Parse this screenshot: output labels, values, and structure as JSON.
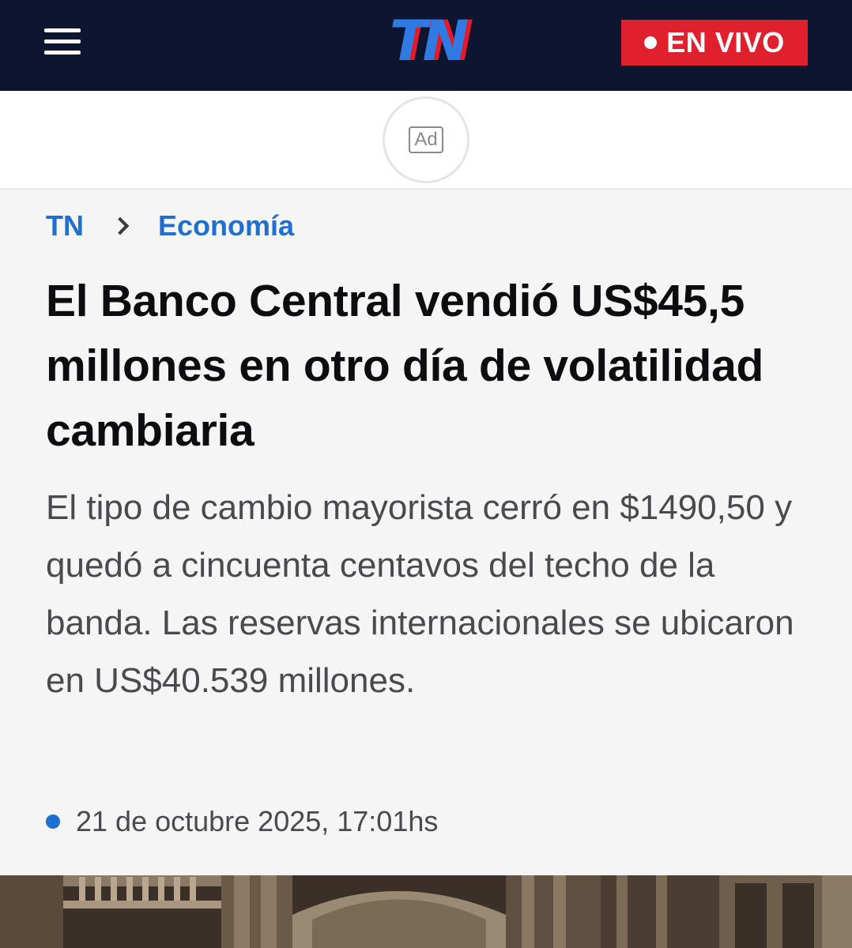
{
  "header": {
    "logo_text": "TN",
    "menu_icon": "hamburger-menu-icon",
    "live_label": "EN VIVO",
    "colors": {
      "background": "#0e1530",
      "logo_blue": "#2f7be3",
      "logo_red": "#e21b2c",
      "live_red": "#e0212d"
    }
  },
  "ad": {
    "label": "Ad"
  },
  "breadcrumb": {
    "home": "TN",
    "separator_icon": "chevron-right-icon",
    "section": "Economía"
  },
  "article": {
    "headline": "El Banco Central vendió US$45,5 millones en otro día de volatilidad cambiaria",
    "summary": "El tipo de cambio mayorista cerró en $1490,50 y quedó a cincuenta centavos del techo de la banda. Las reservas internacionales se ubicaron en US$40.539 millones.",
    "date": "21 de octubre 2025, 17:01hs"
  },
  "accent_color": "#1f6fd1"
}
